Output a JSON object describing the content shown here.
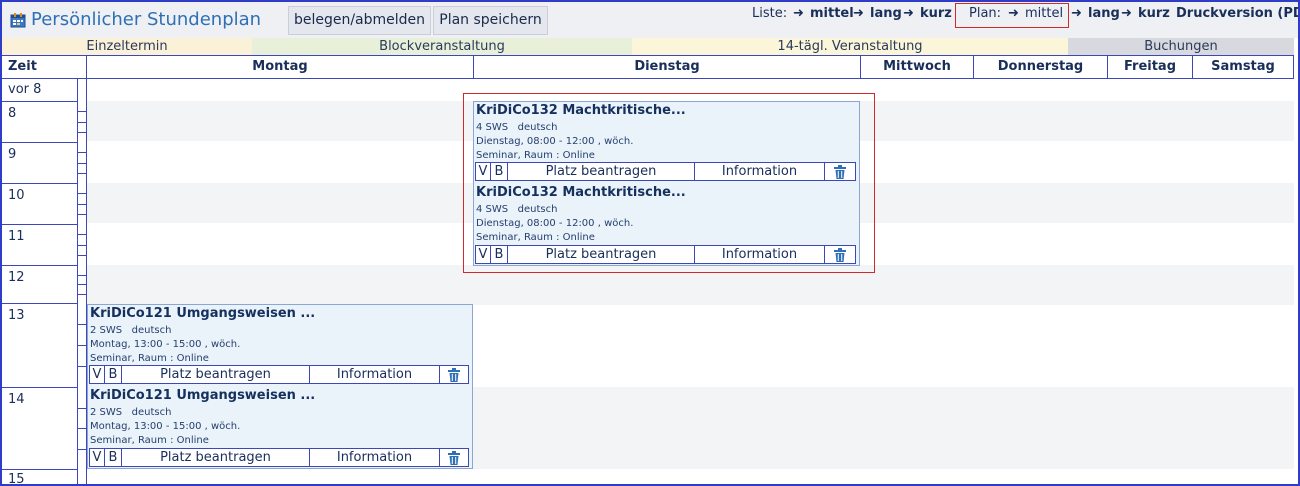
{
  "header": {
    "title": "Persönlicher Stundenplan",
    "buttons": {
      "belegen": "belegen/abmelden",
      "save": "Plan speichern"
    },
    "liste_label": "Liste:",
    "plan_label": "Plan:",
    "views": {
      "mittel": "mittel",
      "lang": "lang",
      "kurz": "kurz"
    },
    "print": "Druckversion (PDF)",
    "icons": {
      "app": "calendar-icon",
      "arrow": "arrow-right-icon"
    }
  },
  "legend": [
    "Einzeltermin",
    "Blockveranstaltung",
    "14-tägl. Veranstaltung",
    "Buchungen"
  ],
  "days": [
    "Zeit",
    "Montag",
    "Dienstag",
    "Mittwoch",
    "Donnerstag",
    "Freitag",
    "Samstag"
  ],
  "hours": [
    "vor 8",
    "8",
    "9",
    "10",
    "11",
    "12",
    "13",
    "14",
    "15"
  ],
  "events": {
    "dienstag": [
      {
        "title": "KriDiCo132 Machtkritische...",
        "sws": "4 SWS",
        "lang": "deutsch",
        "time": "Dienstag,  08:00 - 12:00 , wöch.",
        "type": "Seminar, Raum : Online",
        "v": "V",
        "b": "B",
        "request": "Platz beantragen",
        "info": "Information"
      },
      {
        "title": "KriDiCo132 Machtkritische...",
        "sws": "4 SWS",
        "lang": "deutsch",
        "time": "Dienstag,  08:00 - 12:00 , wöch.",
        "type": "Seminar, Raum : Online",
        "v": "V",
        "b": "B",
        "request": "Platz beantragen",
        "info": "Information"
      }
    ],
    "montag": [
      {
        "title": "KriDiCo121 Umgangsweisen ...",
        "sws": "2 SWS",
        "lang": "deutsch",
        "time": "Montag,  13:00 - 15:00 , wöch.",
        "type": "Seminar, Raum : Online",
        "v": "V",
        "b": "B",
        "request": "Platz beantragen",
        "info": "Information"
      },
      {
        "title": "KriDiCo121 Umgangsweisen ...",
        "sws": "2 SWS",
        "lang": "deutsch",
        "time": "Montag,  13:00 - 15:00 , wöch.",
        "type": "Seminar, Raum : Online",
        "v": "V",
        "b": "B",
        "request": "Platz beantragen",
        "info": "Information"
      }
    ]
  },
  "colors": {
    "accent": "#2f6fb5",
    "border": "#3c48b8",
    "highlight": "#d02b2b"
  }
}
